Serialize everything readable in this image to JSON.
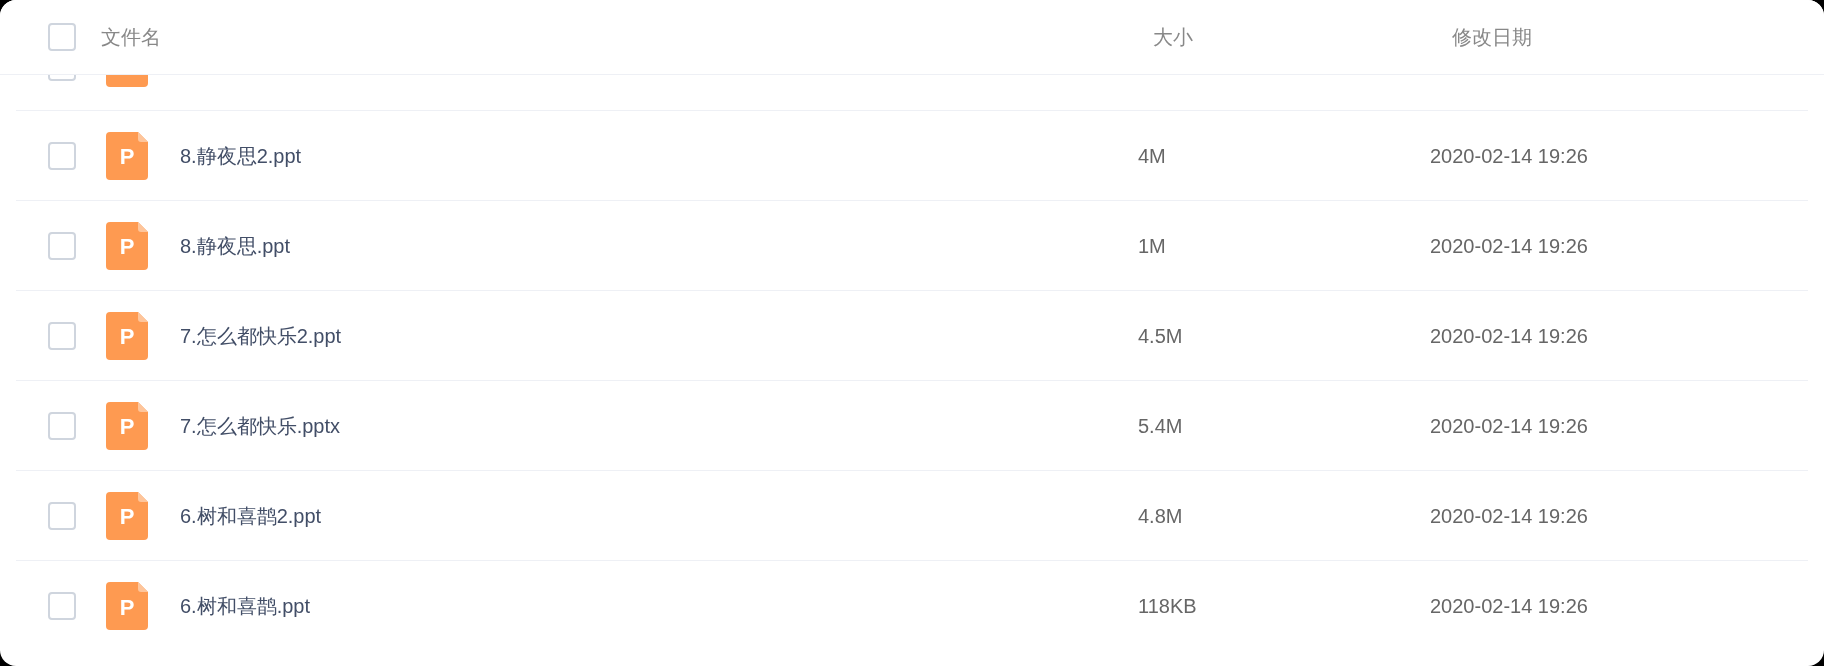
{
  "header": {
    "checked": false,
    "columns": [
      "文件名",
      "大小",
      "修改日期"
    ]
  },
  "partial_row": {
    "checked": false
  },
  "rows": [
    {
      "checked": false,
      "icon_label": "P",
      "name": "8.静夜思2.ppt",
      "size": "4M",
      "modified": "2020-02-14 19:26"
    },
    {
      "checked": false,
      "icon_label": "P",
      "name": "8.静夜思.ppt",
      "size": "1M",
      "modified": "2020-02-14 19:26"
    },
    {
      "checked": false,
      "icon_label": "P",
      "name": "7.怎么都快乐2.ppt",
      "size": "4.5M",
      "modified": "2020-02-14 19:26"
    },
    {
      "checked": false,
      "icon_label": "P",
      "name": "7.怎么都快乐.pptx",
      "size": "5.4M",
      "modified": "2020-02-14 19:26"
    },
    {
      "checked": false,
      "icon_label": "P",
      "name": "6.树和喜鹊2.ppt",
      "size": "4.8M",
      "modified": "2020-02-14 19:26"
    },
    {
      "checked": false,
      "icon_label": "P",
      "name": "6.树和喜鹊.ppt",
      "size": "118KB",
      "modified": "2020-02-14 19:26"
    }
  ]
}
